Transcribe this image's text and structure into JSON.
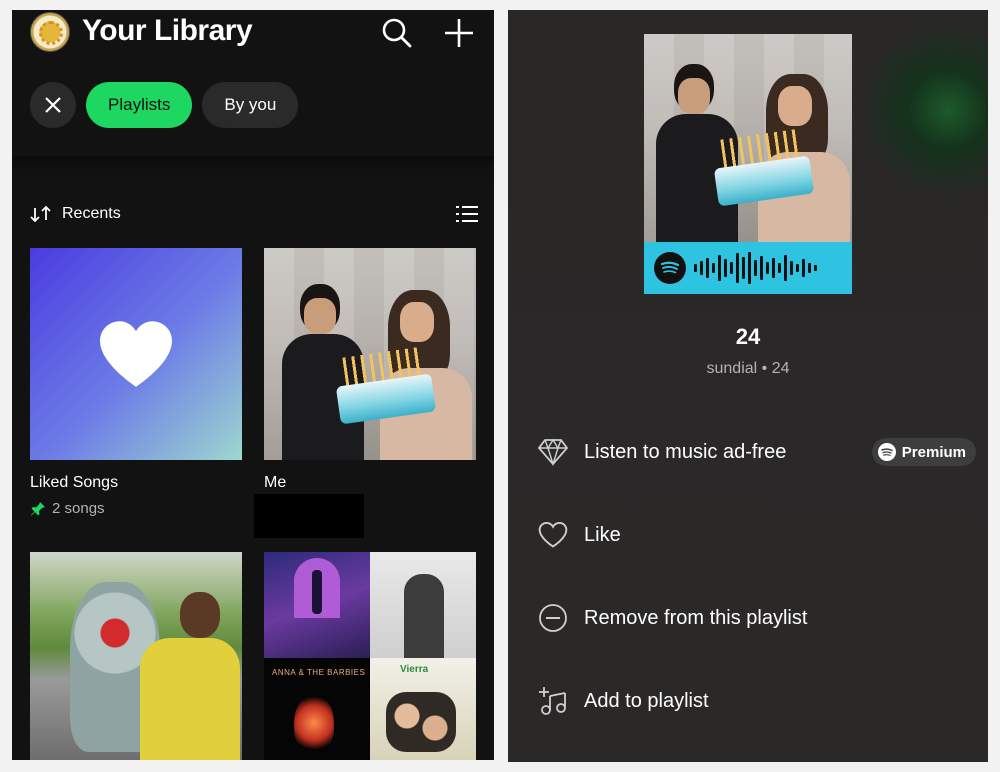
{
  "library": {
    "title": "Your Library",
    "filters": {
      "active": "Playlists",
      "second": "By you"
    },
    "sort_label": "Recents",
    "items": [
      {
        "title": "Liked Songs",
        "subtitle": "2 songs"
      },
      {
        "title": "Me"
      }
    ],
    "mosaic_labels": {
      "bottom_left": "ANNA & THE BARBIES",
      "bottom_right": "Vierra"
    }
  },
  "song": {
    "title": "24",
    "subtitle": "sundial • 24"
  },
  "menu": {
    "items": [
      {
        "label": "Listen to music ad-free",
        "icon": "diamond-icon"
      },
      {
        "label": "Like",
        "icon": "heart-outline-icon"
      },
      {
        "label": "Remove from this playlist",
        "icon": "remove-circle-icon"
      },
      {
        "label": "Add to playlist",
        "icon": "add-to-playlist-icon"
      }
    ],
    "premium_badge": "Premium"
  },
  "colors": {
    "accent": "#1ed760",
    "code_bg": "#2ec3e0"
  }
}
